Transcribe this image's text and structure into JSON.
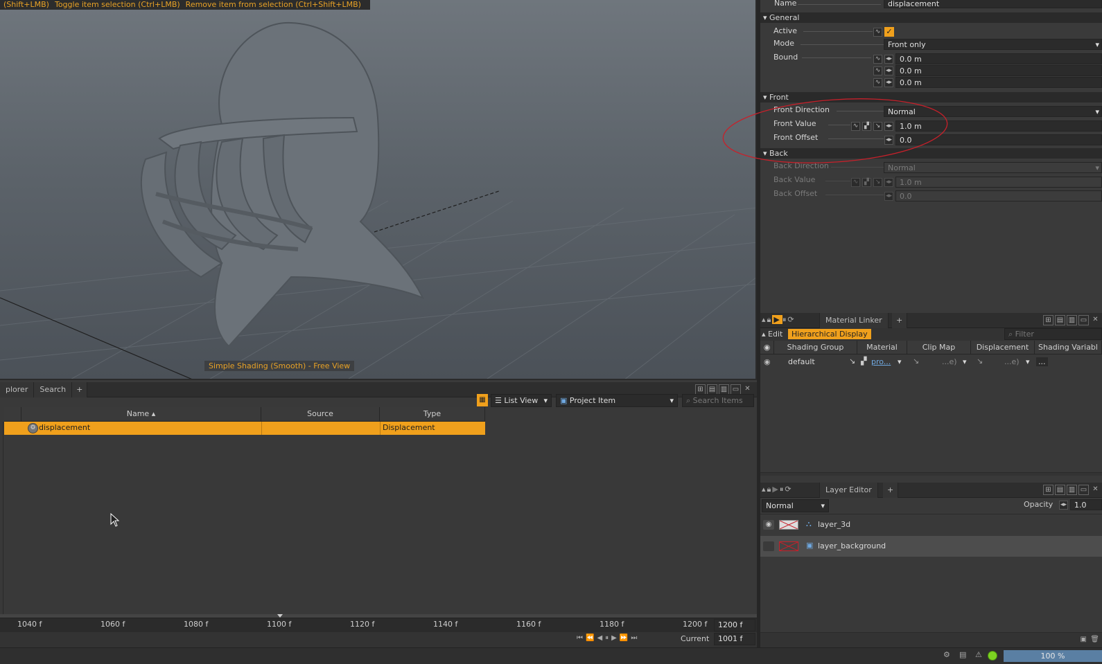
{
  "viewport": {
    "hints": [
      "(Shift+LMB)",
      "Toggle item selection (Ctrl+LMB)",
      "Remove item from selection (Ctrl+Shift+LMB)"
    ],
    "caption": "Simple Shading (Smooth) - Free View"
  },
  "explorer": {
    "tabs": [
      "plorer",
      "Search",
      "+"
    ],
    "view_mode": "List View",
    "filter_type": "Project Item",
    "search_placeholder": "Search Items",
    "columns": [
      "Name ▴",
      "Source",
      "Type"
    ],
    "rows": [
      {
        "name": "displacement",
        "source": "",
        "type": "Displacement"
      }
    ]
  },
  "timeline": {
    "ticks": [
      "1040 f",
      "1060 f",
      "1080 f",
      "1100 f",
      "1120 f",
      "1140 f",
      "1160 f",
      "1180 f",
      "1200 f"
    ],
    "end_frame": "1200 f",
    "current_label": "Current",
    "current_frame": "1001 f"
  },
  "properties": {
    "name_label": "Name",
    "name_value": "displacement",
    "general": {
      "header": "General",
      "active_label": "Active",
      "active": true,
      "mode_label": "Mode",
      "mode_value": "Front only",
      "bound_label": "Bound",
      "bound_values": [
        "0.0 m",
        "0.0 m",
        "0.0 m"
      ]
    },
    "front": {
      "header": "Front",
      "direction_label": "Front Direction",
      "direction_value": "Normal",
      "value_label": "Front Value",
      "value_value": "1.0 m",
      "offset_label": "Front Offset",
      "offset_value": "0.0"
    },
    "back": {
      "header": "Back",
      "direction_label": "Back Direction",
      "direction_value": "Normal",
      "value_label": "Back Value",
      "value_value": "1.0 m",
      "offset_label": "Back Offset",
      "offset_value": "0.0"
    }
  },
  "material_linker": {
    "tab": "Material Linker",
    "add_tab": "+",
    "edit_label": "Edit",
    "hier_label": "Hierarchical Display",
    "filter_placeholder": "Filter",
    "columns": [
      "Shading Group",
      "Material",
      "Clip Map",
      "Displacement",
      "Shading Variabl"
    ],
    "row": {
      "group": "default",
      "material": "pro...",
      "clip": "...e)",
      "disp": "...e)",
      "var": "..."
    }
  },
  "layer_editor": {
    "tab": "Layer Editor",
    "add_tab": "+",
    "blend_mode": "Normal",
    "opacity_label": "Opacity",
    "opacity_value": "1.0",
    "layers": [
      {
        "name": "layer_3d",
        "visible": true,
        "selected": false
      },
      {
        "name": "layer_background",
        "visible": false,
        "selected": true
      }
    ]
  },
  "statusbar": {
    "zoom": "100 %"
  },
  "colors": {
    "accent": "#f0a01c",
    "annotation": "#c8202a"
  }
}
